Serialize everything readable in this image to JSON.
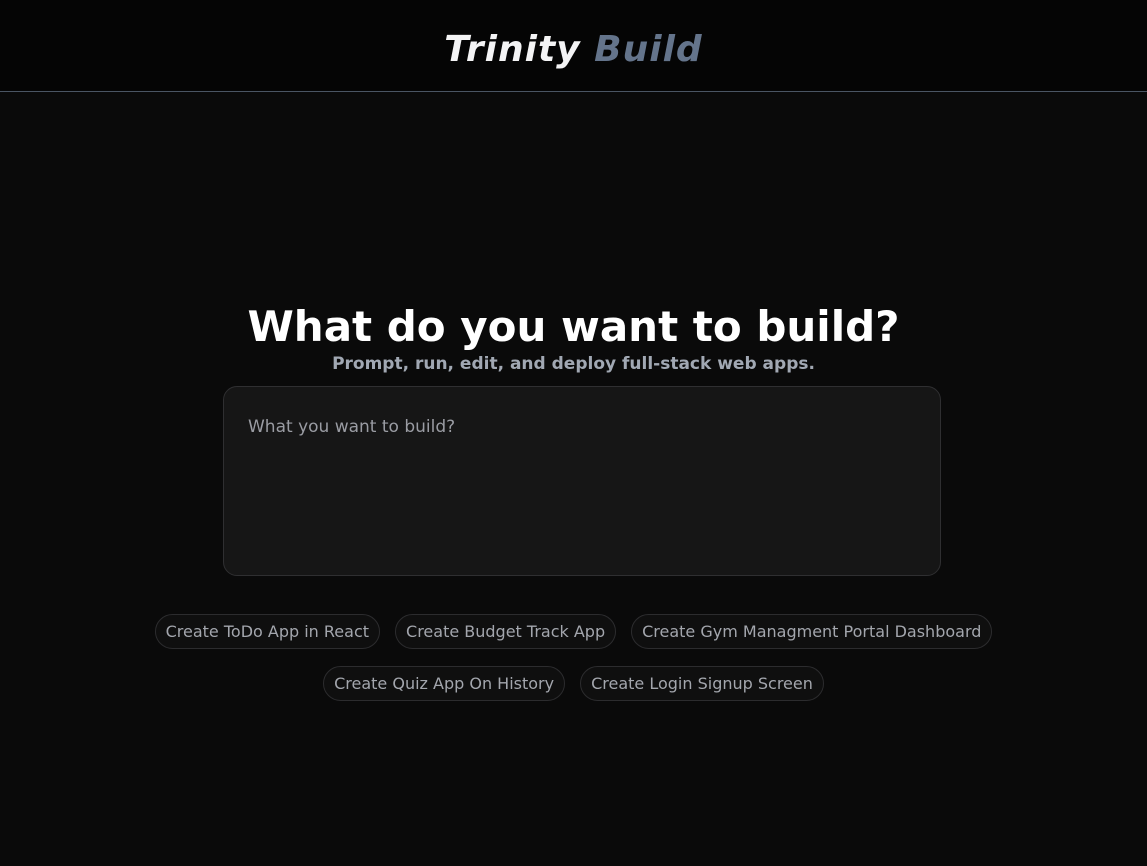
{
  "header": {
    "brand_primary": "Trinity",
    "brand_accent": "Build"
  },
  "hero": {
    "title": "What do you want to build?",
    "subtitle": "Prompt, run, edit, and deploy full-stack web apps."
  },
  "prompt": {
    "placeholder": "What you want to build?",
    "value": ""
  },
  "suggestions": [
    "Create ToDo App in React",
    "Create Budget Track App",
    "Create Gym Managment Portal Dashboard",
    "Create Quiz App On History",
    "Create Login Signup Screen"
  ],
  "colors": {
    "background": "#0a0a0a",
    "brand_accent": "#64748b",
    "header_border": "#4a5563",
    "input_background": "#161616"
  }
}
